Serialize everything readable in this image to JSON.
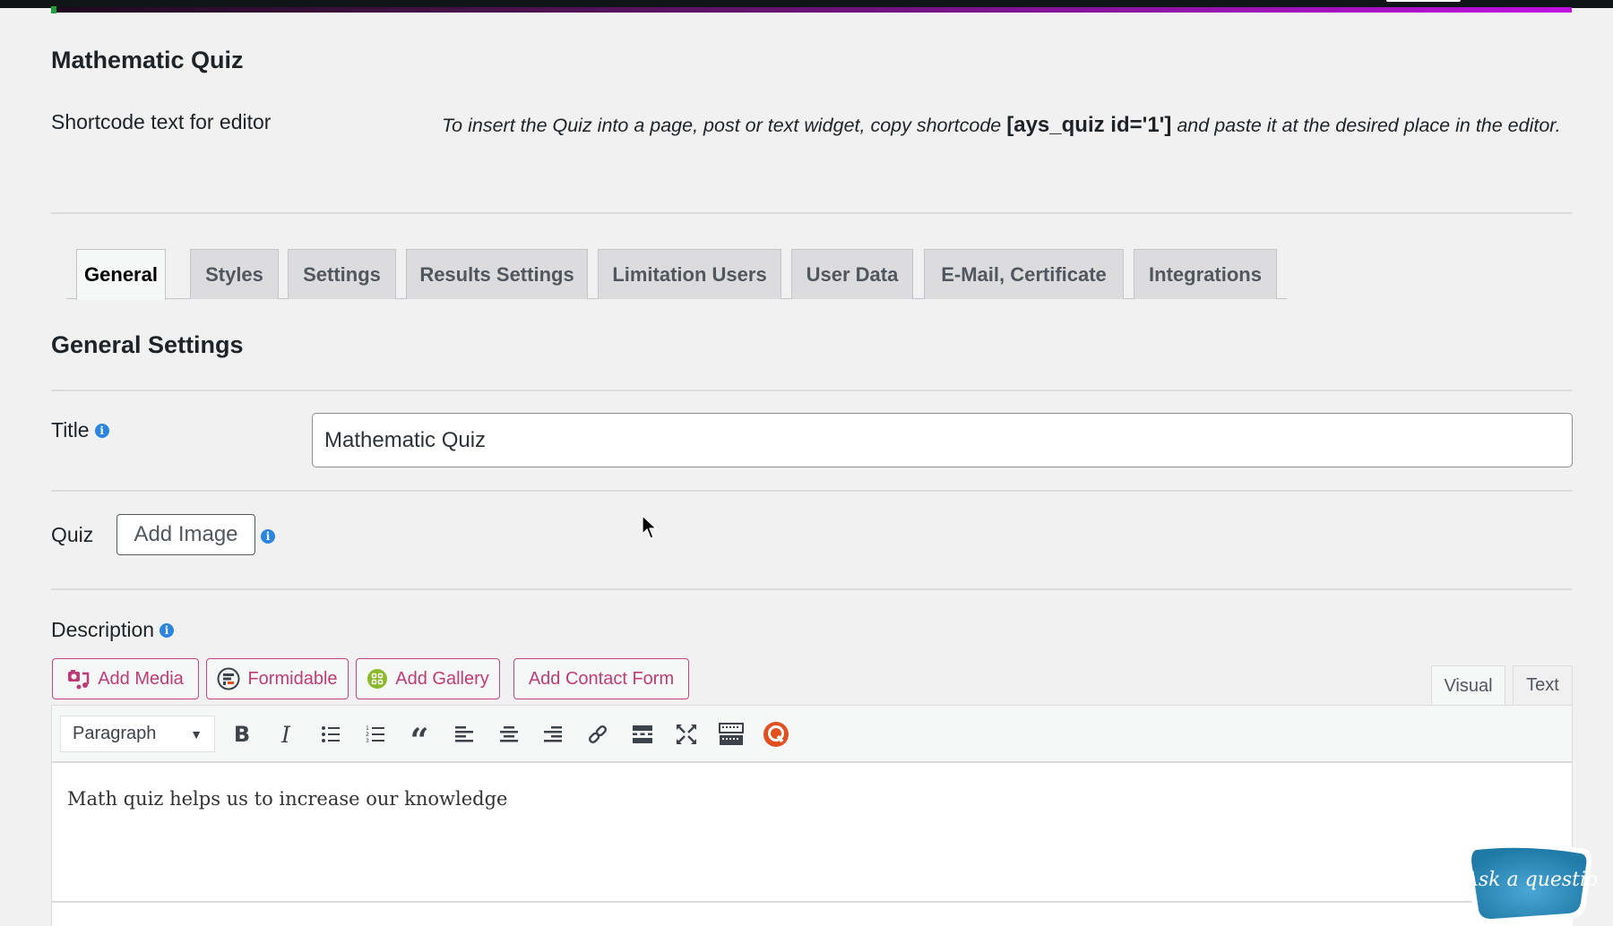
{
  "header": {
    "page_title": "Mathematic Quiz"
  },
  "shortcode": {
    "label": "Shortcode text for editor",
    "text_before": "To insert the Quiz into a page, post or text widget, copy shortcode ",
    "code": "[ays_quiz id='1']",
    "text_after": " and paste it at the desired place in the editor."
  },
  "tabs": [
    {
      "label": "General",
      "active": true
    },
    {
      "label": "Styles",
      "active": false
    },
    {
      "label": "Settings",
      "active": false
    },
    {
      "label": "Results Settings",
      "active": false
    },
    {
      "label": "Limitation Users",
      "active": false
    },
    {
      "label": "User Data",
      "active": false
    },
    {
      "label": "E-Mail, Certificate",
      "active": false
    },
    {
      "label": "Integrations",
      "active": false
    }
  ],
  "general": {
    "section_title": "General Settings",
    "title_label": "Title",
    "title_value": "Mathematic Quiz",
    "quiz_label": "Quiz",
    "add_image_label": "Add Image",
    "description_label": "Description"
  },
  "media_buttons": [
    {
      "label": "Add Media",
      "icon": "add-media-icon"
    },
    {
      "label": "Formidable",
      "icon": "formidable-icon"
    },
    {
      "label": "Add Gallery",
      "icon": "gallery-icon"
    },
    {
      "label": "Add Contact Form",
      "icon": ""
    }
  ],
  "editor": {
    "tab_visual": "Visual",
    "tab_text": "Text",
    "format_select": "Paragraph",
    "toolbar_icons": [
      "bold-icon",
      "italic-icon",
      "bullet-list-icon",
      "numbered-list-icon",
      "blockquote-icon",
      "align-left-icon",
      "align-center-icon",
      "align-right-icon",
      "link-icon",
      "read-more-icon",
      "fullscreen-icon",
      "toolbar-toggle-icon",
      "quiz-plugin-icon"
    ],
    "content": "Math quiz helps us to increase our knowledge"
  },
  "widget": {
    "ask_label": "Ask a question"
  },
  "colors": {
    "accent_pink": "#bf3c77",
    "info_blue": "#2b86e0",
    "gallery_green": "#8cb82b",
    "quiz_orange": "#e2501f",
    "widget_blue": "#2e8bb8"
  }
}
